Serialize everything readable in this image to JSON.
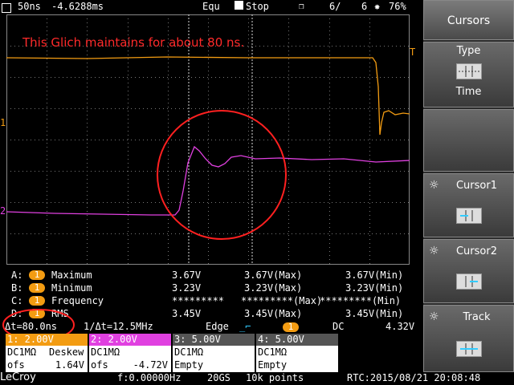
{
  "topbar": {
    "timebase": "50ns",
    "delay": "-4.6288ms",
    "trigger_mode": "Equ",
    "run_state": "Stop",
    "sequence_current": "6/",
    "sequence_total": "6",
    "battery": "76%"
  },
  "annotation": "This Glich maintains for about 80 ns.",
  "markers": {
    "trig_right": "T",
    "ch1": "1",
    "ch2": "2"
  },
  "measurements": [
    {
      "slot": "A:",
      "ch": "1",
      "name": "Maximum",
      "value": "3.67V",
      "max": "3.67V(Max)",
      "min": "3.67V(Min)"
    },
    {
      "slot": "B:",
      "ch": "1",
      "name": "Minimum",
      "value": "3.23V",
      "max": "3.23V(Max)",
      "min": "3.23V(Min)"
    },
    {
      "slot": "C:",
      "ch": "1",
      "name": "Frequency",
      "value": "*********",
      "max": "*********(Max)",
      "min": "*********(Min)"
    },
    {
      "slot": "D:",
      "ch": "1",
      "name": "RMS",
      "value": "3.45V",
      "max": "3.45V(Max)",
      "min": "3.45V(Min)"
    }
  ],
  "info": {
    "delta_t": "Δt=80.0ns",
    "inv_delta_t": "1/Δt=12.5MHz",
    "trigger_type": "Edge",
    "trigger_ch": "1",
    "coupling": "DC",
    "level": "4.32V"
  },
  "channels": [
    {
      "head": "1: 2.00V",
      "coupling": "DC1MΩ",
      "extra": "Deskew",
      "ofs_label": "ofs",
      "ofs": "1.64V",
      "head_color": "#f39c12"
    },
    {
      "head": "2: 2.00V",
      "coupling": "DC1MΩ",
      "extra": "",
      "ofs_label": "ofs",
      "ofs": "-4.72V",
      "head_color": "#e040e0"
    },
    {
      "head": "3: 5.00V",
      "coupling": "DC1MΩ",
      "extra": "",
      "ofs_label": "Empty",
      "ofs": "",
      "head_color": "#555555"
    },
    {
      "head": "4: 5.00V",
      "coupling": "DC1MΩ",
      "extra": "",
      "ofs_label": "Empty",
      "ofs": "",
      "head_color": "#555555"
    }
  ],
  "bottombar": {
    "brand": "LeCroy",
    "freq": "f:0.00000Hz",
    "sample_rate": "20GS",
    "points": "10k points",
    "rtc": "RTC:2015/08/21 20:08:48"
  },
  "menu": {
    "cursors": "Cursors",
    "type_label": "Type",
    "type_value": "Time",
    "cursor1": "Cursor1",
    "cursor2": "Cursor2",
    "track": "Track"
  },
  "colors": {
    "ch1": "#f39c12",
    "ch2": "#e040e0",
    "annotation": "#ff2a2a"
  }
}
